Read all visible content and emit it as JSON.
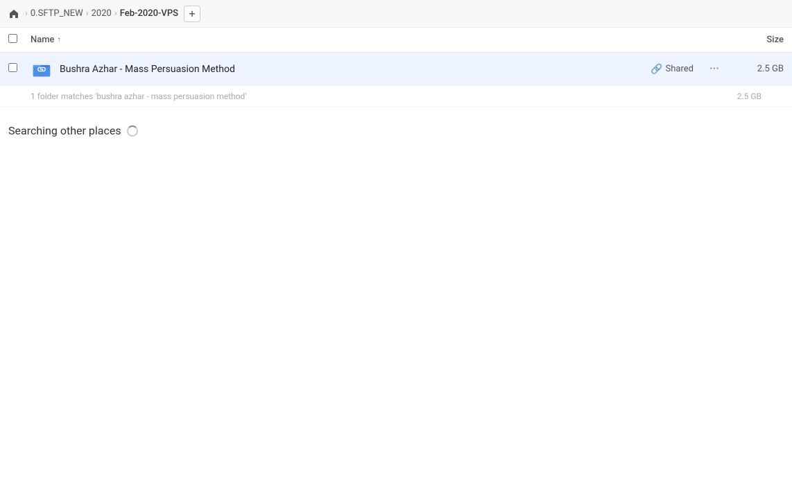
{
  "toolbar": {
    "home_icon": "home",
    "breadcrumbs": [
      {
        "label": "0.SFTP_NEW",
        "active": false
      },
      {
        "label": "2020",
        "active": false
      },
      {
        "label": "Feb-2020-VPS",
        "active": true
      }
    ],
    "add_button_label": "+"
  },
  "column_headers": {
    "checkbox_label": "",
    "name_label": "Name",
    "sort_indicator": "↑",
    "size_label": "Size"
  },
  "file_row": {
    "name": "Bushra Azhar - Mass Persuasion Method",
    "shared_label": "Shared",
    "size": "2.5 GB",
    "more_icon": "···",
    "link_icon": "🔗"
  },
  "match_info": {
    "text": "1 folder matches 'bushra azhar - mass persuasion method'",
    "size": "2.5 GB"
  },
  "searching": {
    "label": "Searching other places"
  }
}
